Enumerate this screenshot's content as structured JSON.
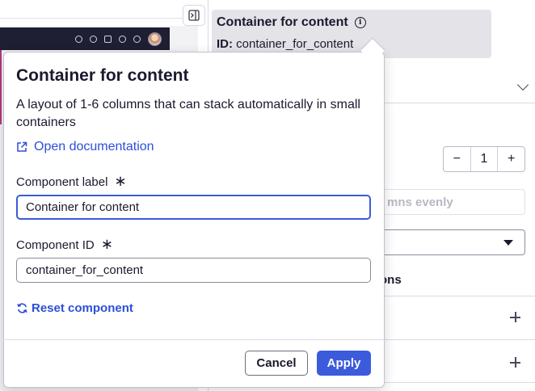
{
  "header": {
    "title": "Container for content",
    "id_label": "ID:",
    "id_value": "container_for_content"
  },
  "properties": {
    "column_count": "1",
    "decrement_label": "−",
    "increment_label": "+",
    "distribute_button_label": "mns evenly",
    "section_label": "ons"
  },
  "popover": {
    "title": "Container for content",
    "description": "A layout of 1-6 columns that can stack automatically in small containers",
    "doc_link_label": "Open documentation",
    "label_field": {
      "label": "Component label",
      "required_mark": "∗",
      "value": "Container for content"
    },
    "id_field": {
      "label": "Component ID",
      "required_mark": "∗",
      "value": "container_for_content"
    },
    "reset_label": "Reset component",
    "cancel_label": "Cancel",
    "apply_label": "Apply"
  },
  "colors": {
    "accent": "#3b5bdb",
    "link": "#2d4fd8",
    "app_header_dark": "#1e1f33",
    "header_chip": "#e3e3e8"
  },
  "icons": [
    "collapse-panel-icon",
    "info-icon",
    "chevron-down-icon",
    "external-link-icon",
    "refresh-icon",
    "plus-icon",
    "caret-down-icon"
  ]
}
